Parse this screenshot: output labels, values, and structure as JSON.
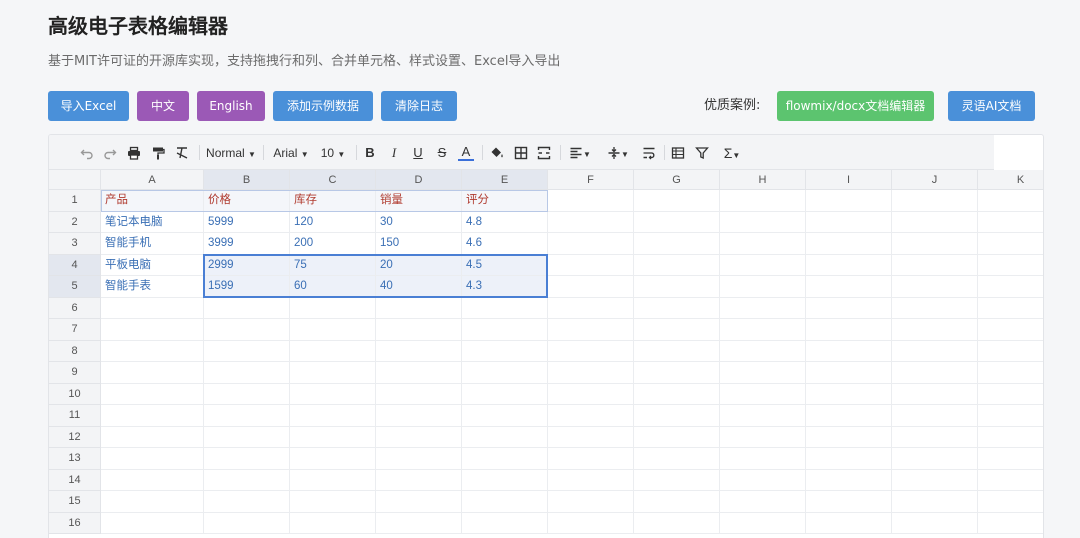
{
  "header": {
    "title": "高级电子表格编辑器",
    "subtitle": "基于MIT许可证的开源库实现，支持拖拽行和列、合并单元格、样式设置、Excel导入导出"
  },
  "buttons": {
    "import_excel": "导入Excel",
    "lang_zh": "中文",
    "lang_en": "English",
    "add_sample": "添加示例数据",
    "clear_log": "清除日志",
    "cases_label": "优质案例:",
    "flowmix": "flowmix/docx文档编辑器",
    "lingyu": "灵语AI文档"
  },
  "colors": {
    "blue": "#4a90d9",
    "purple": "#9b59b6",
    "green": "#5cc46f",
    "header_text": "#b03a2e",
    "value_text": "#3a6fb5",
    "selection": "#4a7fd4"
  },
  "toolbar": {
    "icons": [
      "undo-icon",
      "redo-icon",
      "print-icon",
      "paint-format-icon",
      "clear-format-icon",
      "bold-icon",
      "italic-icon",
      "underline-icon",
      "strikethrough-icon",
      "text-color-icon",
      "fill-color-icon",
      "borders-icon",
      "merge-cells-icon",
      "align-horizontal-icon",
      "align-vertical-icon",
      "wrap-text-icon",
      "freeze-icon",
      "filter-icon",
      "function-icon"
    ],
    "style": "Normal",
    "font": "Arial",
    "size": "10",
    "glyphs": {
      "bold": "B",
      "italic": "I",
      "underline": "U",
      "strike": "S",
      "text_color": "A",
      "sum": "Σ"
    }
  },
  "sheet": {
    "columns": [
      "A",
      "B",
      "C",
      "D",
      "E",
      "F",
      "G",
      "H",
      "I",
      "J",
      "K"
    ],
    "rows": [
      "1",
      "2",
      "3",
      "4",
      "5",
      "6",
      "7",
      "8",
      "9",
      "10",
      "11",
      "12",
      "13",
      "14",
      "15",
      "16"
    ],
    "data": [
      [
        "产品",
        "价格",
        "库存",
        "销量",
        "评分"
      ],
      [
        "笔记本电脑",
        "5999",
        "120",
        "30",
        "4.8"
      ],
      [
        "智能手机",
        "3999",
        "200",
        "150",
        "4.6"
      ],
      [
        "平板电脑",
        "2999",
        "75",
        "20",
        "4.5"
      ],
      [
        "智能手表",
        "1599",
        "60",
        "40",
        "4.3"
      ]
    ],
    "selection": "B4:E5"
  }
}
